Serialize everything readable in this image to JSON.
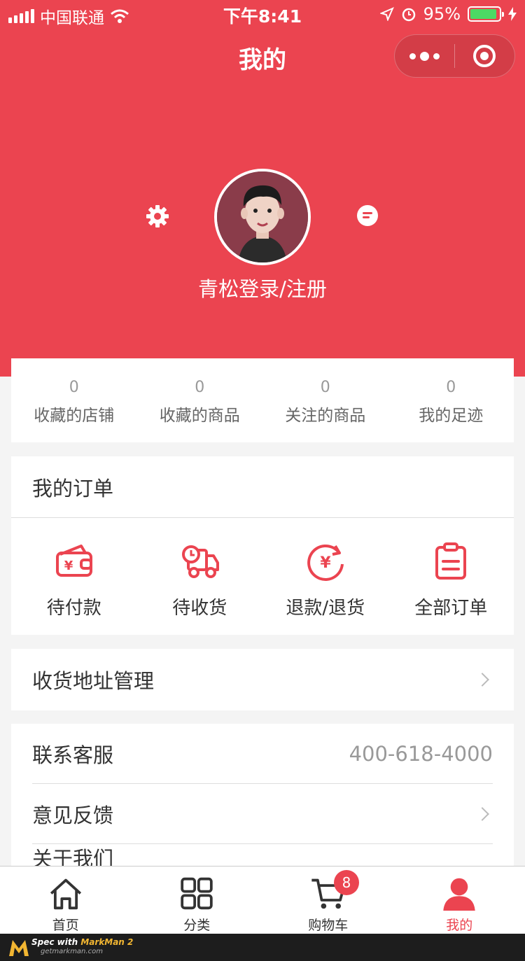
{
  "status_bar": {
    "carrier": "中国联通",
    "time": "下午8:41",
    "battery": "95%"
  },
  "header": {
    "title": "我的",
    "login_text": "青松登录/注册",
    "accent_color": "#eb4450"
  },
  "stats": [
    {
      "value": "0",
      "label": "收藏的店铺"
    },
    {
      "value": "0",
      "label": "收藏的商品"
    },
    {
      "value": "0",
      "label": "关注的商品"
    },
    {
      "value": "0",
      "label": "我的足迹"
    }
  ],
  "orders": {
    "title": "我的订单",
    "items": [
      {
        "label": "待付款",
        "icon": "wallet-icon"
      },
      {
        "label": "待收货",
        "icon": "truck-icon"
      },
      {
        "label": "退款/退货",
        "icon": "refund-icon"
      },
      {
        "label": "全部订单",
        "icon": "clipboard-icon"
      }
    ]
  },
  "menu": {
    "address": "收货地址管理",
    "service": "联系客服",
    "service_phone": "400-618-4000",
    "feedback": "意见反馈",
    "about": "关于我们"
  },
  "tabbar": {
    "items": [
      {
        "label": "首页",
        "icon": "home-icon"
      },
      {
        "label": "分类",
        "icon": "category-icon"
      },
      {
        "label": "购物车",
        "icon": "cart-icon",
        "badge": "8"
      },
      {
        "label": "我的",
        "icon": "user-icon",
        "active": true
      }
    ]
  },
  "footer": {
    "spec_prefix": "Spec with ",
    "spec_brand": "MarkMan 2",
    "site": "getmarkman.com"
  }
}
